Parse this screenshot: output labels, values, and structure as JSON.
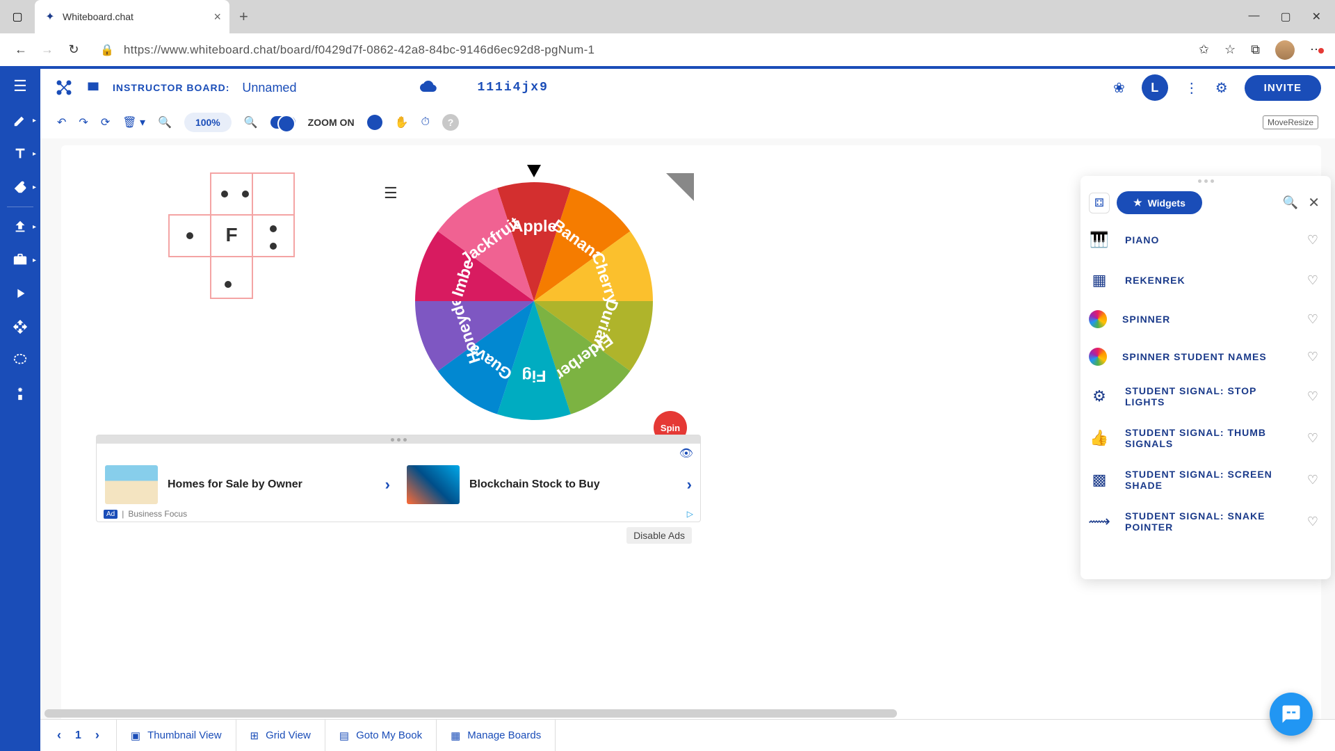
{
  "browser": {
    "tab_title": "Whiteboard.chat",
    "url": "https://www.whiteboard.chat/board/f0429d7f-0862-42a8-84bc-9146d6ec92d8-pgNum-1"
  },
  "header": {
    "instructor_label": "INSTRUCTOR BOARD:",
    "board_name": "Unnamed",
    "board_code": "111i4jx9",
    "user_initial": "L",
    "invite_label": "INVITE"
  },
  "toolbar": {
    "zoom_pct": "100%",
    "zoom_label": "ZOOM ON",
    "move_resize": "MoveResize"
  },
  "spinner": {
    "segments": [
      {
        "label": "Apple",
        "color": "#d32f2f"
      },
      {
        "label": "Banana",
        "color": "#f57c00"
      },
      {
        "label": "Cherry",
        "color": "#fbc02d"
      },
      {
        "label": "Durian",
        "color": "#afb42b"
      },
      {
        "label": "Elderberry",
        "color": "#7cb342"
      },
      {
        "label": "Fig",
        "color": "#00acc1"
      },
      {
        "label": "Guava",
        "color": "#0288d1"
      },
      {
        "label": "Honeydew",
        "color": "#7e57c2"
      },
      {
        "label": "Imbe",
        "color": "#d81b60"
      },
      {
        "label": "Jackfruit",
        "color": "#f06292"
      }
    ],
    "spin_label": "Spin"
  },
  "pentomino": {
    "letter": "F"
  },
  "ads": {
    "items": [
      {
        "title": "Homes for Sale by Owner"
      },
      {
        "title": "Blockchain Stock to Buy"
      }
    ],
    "footer": "Business Focus",
    "ad_tag": "Ad",
    "disable": "Disable Ads"
  },
  "widget_panel": {
    "title": "Widgets",
    "items": [
      {
        "icon": "piano",
        "label": "PIANO"
      },
      {
        "icon": "grid",
        "label": "REKENREK"
      },
      {
        "icon": "rainbow",
        "label": "SPINNER"
      },
      {
        "icon": "rainbow",
        "label": "SPINNER STUDENT NAMES"
      },
      {
        "icon": "gear",
        "label": "STUDENT SIGNAL: STOP LIGHTS"
      },
      {
        "icon": "thumb",
        "label": "STUDENT SIGNAL: THUMB SIGNALS"
      },
      {
        "icon": "shade",
        "label": "STUDENT SIGNAL: SCREEN SHADE"
      },
      {
        "icon": "snake",
        "label": "STUDENT SIGNAL: SNAKE POINTER"
      }
    ]
  },
  "bottom_bar": {
    "page": "1",
    "thumbnail": "Thumbnail View",
    "grid": "Grid View",
    "goto": "Goto My Book",
    "manage": "Manage Boards"
  }
}
